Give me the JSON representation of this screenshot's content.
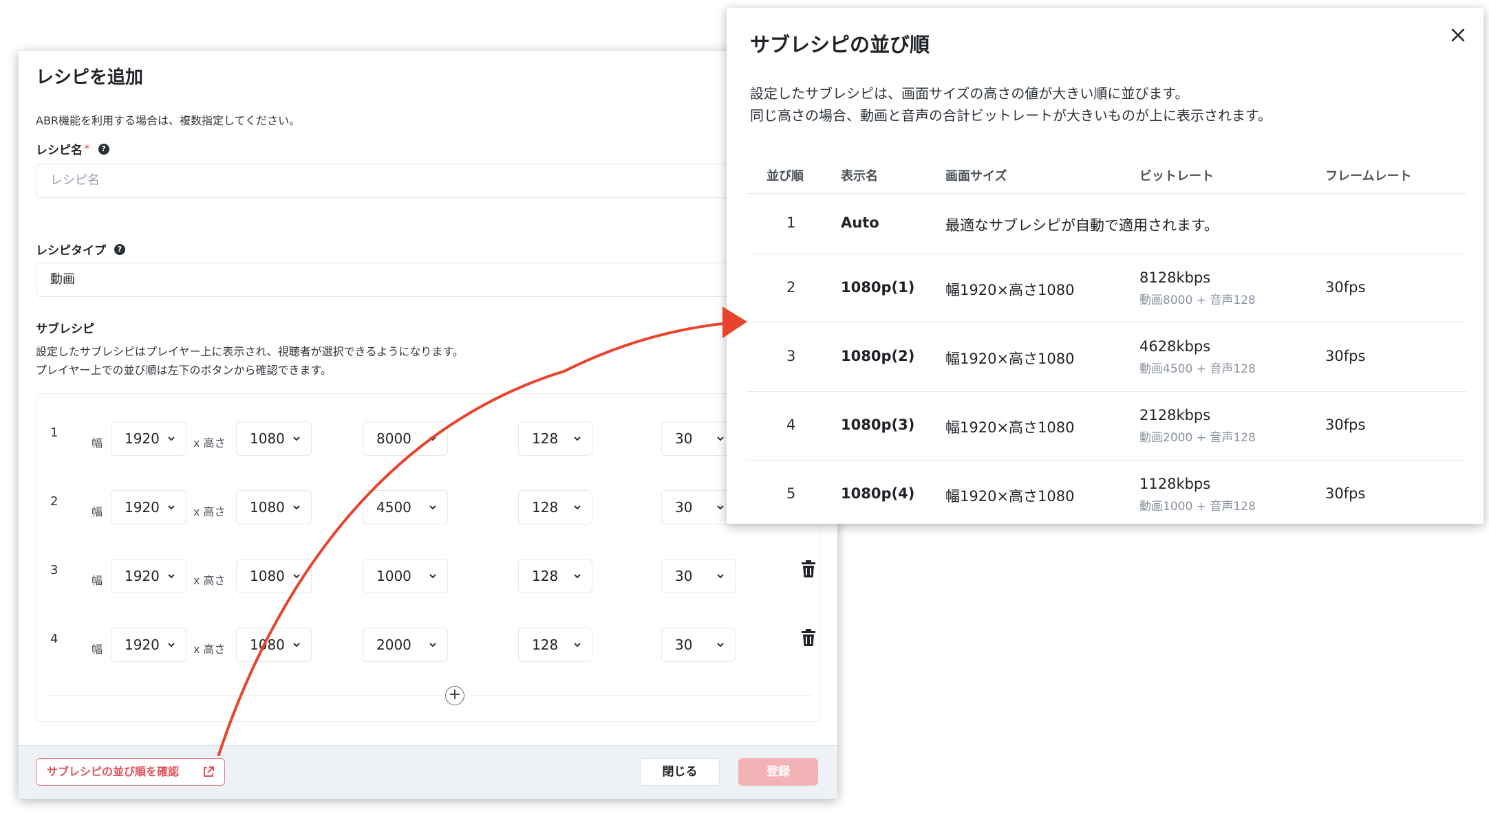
{
  "main_dialog": {
    "title": "レシピを追加",
    "description": "ABR機能を利用する場合は、複数指定してください。",
    "recipe_name_label": "レシピ名",
    "required_mark": "*",
    "recipe_name_placeholder": "レシピ名",
    "recipe_type_label": "レシピタイプ",
    "recipe_type_value": "動画",
    "subrecipe_label": "サブレシピ",
    "subrecipe_desc_1": "設定したサブレシピはプレイヤー上に表示され、視聴者が選択できるようになります。",
    "subrecipe_desc_2": "プレイヤー上での並び順は左下のボタンから確認できます。",
    "width_label": "幅",
    "height_label": "x 高さ",
    "add_symbol": "+",
    "rows": [
      {
        "num": "1",
        "width": "1920",
        "height": "1080",
        "video_bitrate": "8000",
        "audio_bitrate": "128",
        "fps": "30"
      },
      {
        "num": "2",
        "width": "1920",
        "height": "1080",
        "video_bitrate": "4500",
        "audio_bitrate": "128",
        "fps": "30"
      },
      {
        "num": "3",
        "width": "1920",
        "height": "1080",
        "video_bitrate": "1000",
        "audio_bitrate": "128",
        "fps": "30"
      },
      {
        "num": "4",
        "width": "1920",
        "height": "1080",
        "video_bitrate": "2000",
        "audio_bitrate": "128",
        "fps": "30"
      }
    ],
    "footer": {
      "check_order_label": "サブレシピの並び順を確認",
      "close_label": "閉じる",
      "register_label": "登録"
    }
  },
  "order_dialog": {
    "title": "サブレシピの並び順",
    "desc_1": "設定したサブレシピは、画面サイズの高さの値が大きい順に並びます。",
    "desc_2": "同じ高さの場合、動画と音声の合計ビットレートが大きいものが上に表示されます。",
    "headers": [
      "並び順",
      "表示名",
      "画面サイズ",
      "ビットレート",
      "フレームレート"
    ],
    "auto_row": {
      "order": "1",
      "name": "Auto",
      "text": "最適なサブレシピが自動で適用されます。"
    },
    "rows": [
      {
        "order": "2",
        "name": "1080p(1)",
        "size": "幅1920×高さ1080",
        "bitrate": "8128kbps",
        "bitrate_detail": "動画8000 + 音声128",
        "fps": "30fps"
      },
      {
        "order": "3",
        "name": "1080p(2)",
        "size": "幅1920×高さ1080",
        "bitrate": "4628kbps",
        "bitrate_detail": "動画4500 + 音声128",
        "fps": "30fps"
      },
      {
        "order": "4",
        "name": "1080p(3)",
        "size": "幅1920×高さ1080",
        "bitrate": "2128kbps",
        "bitrate_detail": "動画2000 + 音声128",
        "fps": "30fps"
      },
      {
        "order": "5",
        "name": "1080p(4)",
        "size": "幅1920×高さ1080",
        "bitrate": "1128kbps",
        "bitrate_detail": "動画1000 + 音声128",
        "fps": "30fps"
      }
    ]
  },
  "colors": {
    "accent_red": "#e0505a",
    "register_disabled": "#f3b3b6",
    "arrow_red": "#e8432c"
  }
}
